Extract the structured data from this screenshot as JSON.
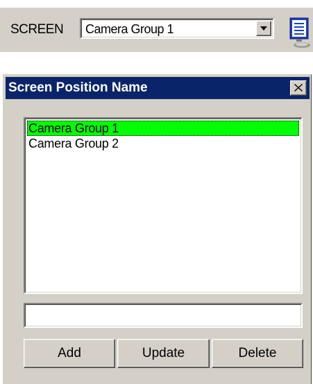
{
  "toolbar": {
    "screen_label": "SCREEN",
    "screen_select": {
      "value": "Camera Group 1"
    },
    "dropdown_icon": "triangle-down-icon",
    "monitor_button_icon": "monitor-icon"
  },
  "dialog": {
    "title": "Screen Position Name",
    "close_icon": "close-x-icon",
    "list": {
      "items": [
        "Camera Group 1",
        "Camera Group 2"
      ],
      "selected_index": 0,
      "selected_color": "#00ff00"
    },
    "name_input": {
      "value": "",
      "placeholder": ""
    },
    "buttons": {
      "add": "Add",
      "update": "Update",
      "delete": "Delete"
    }
  },
  "colors": {
    "face": "#d4d0c8",
    "titlebar": "#0a246a",
    "selection": "#00ff00"
  }
}
